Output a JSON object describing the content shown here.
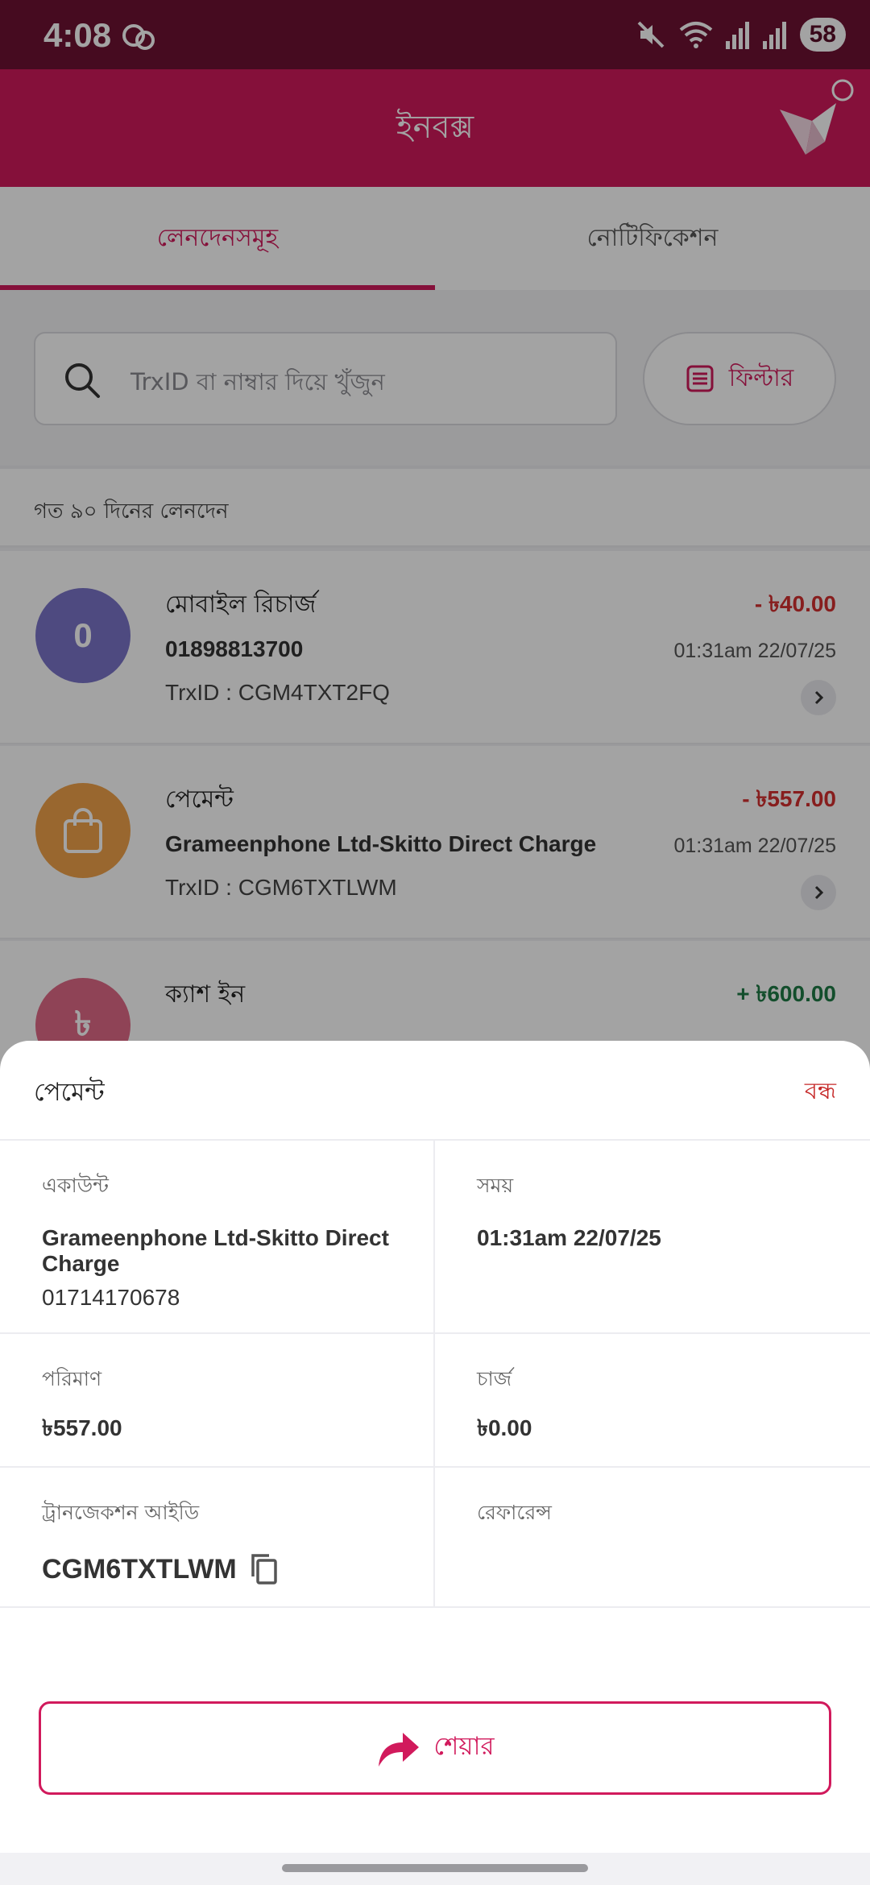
{
  "status_bar": {
    "time": "4:08",
    "battery": "58"
  },
  "app_bar": {
    "title": "ইনবক্স"
  },
  "tabs": [
    {
      "label": "লেনদেনসমূহ",
      "active": true
    },
    {
      "label": "নোটিফিকেশন",
      "active": false
    }
  ],
  "search": {
    "placeholder": "TrxID বা নাম্বার দিয়ে খুঁজুন"
  },
  "filter": {
    "label": "ফিল্টার"
  },
  "list_title": "গত ৯০ দিনের লেনদেন",
  "transactions": [
    {
      "title": "মোবাইল রিচার্জ",
      "subtitle": "01898813700",
      "trxid": "TrxID : CGM4TXT2FQ",
      "amount": "- ৳40.00",
      "time": "01:31am 22/07/25",
      "avatar_text": "0",
      "avatar_color": "#7b74c8"
    },
    {
      "title": "পেমেন্ট",
      "subtitle": "Grameenphone Ltd-Skitto Direct Charge",
      "trxid": "TrxID : CGM6TXTLWM",
      "amount": "- ৳557.00",
      "time": "01:31am 22/07/25",
      "avatar_color": "#f0a24a"
    },
    {
      "title": "ক্যাশ ইন",
      "amount": "+ ৳600.00",
      "avatar_text": "৳",
      "avatar_color": "#e06a87"
    }
  ],
  "sheet": {
    "title": "পেমেন্ট",
    "close_label": "বন্ধ",
    "account": {
      "label": "একাউন্ট",
      "name": "Grameenphone Ltd-Skitto Direct Charge",
      "number": "01714170678"
    },
    "time": {
      "label": "সময়",
      "value": "01:31am 22/07/25"
    },
    "amount": {
      "label": "পরিমাণ",
      "value": "৳557.00"
    },
    "charge": {
      "label": "চার্জ",
      "value": "৳0.00"
    },
    "trxid": {
      "label": "ট্রানজেকশন আইডি",
      "value": "CGM6TXTLWM"
    },
    "reference": {
      "label": "রেফারেন্স",
      "value": ""
    },
    "share_label": "শেয়ার"
  },
  "colors": {
    "brand": "#d11a5c",
    "status_bar": "#6e1232",
    "negative": "#d32f2f",
    "positive": "#1e7a45"
  }
}
